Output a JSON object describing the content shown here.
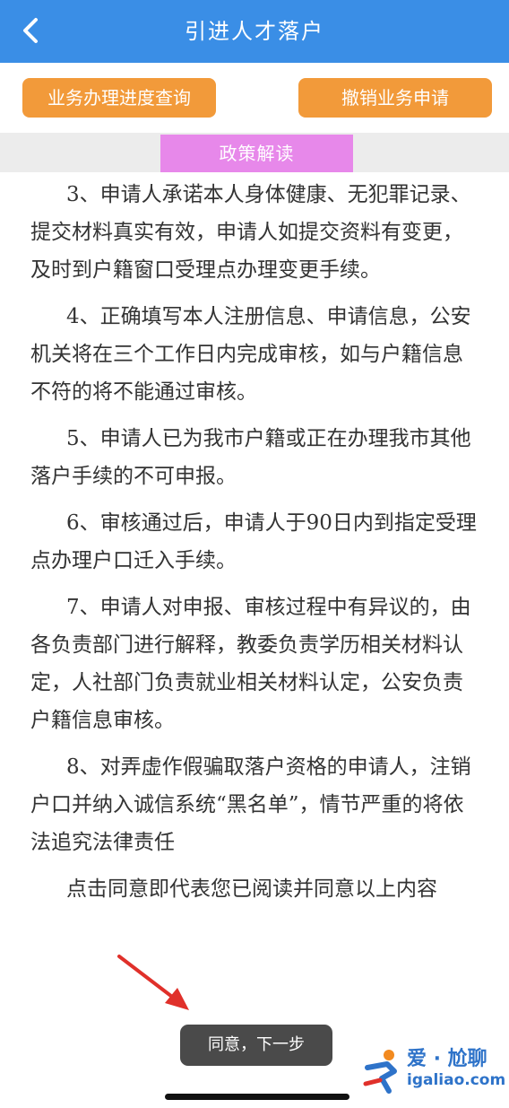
{
  "header": {
    "title": "引进人才落户",
    "back_icon": "chevron-left-icon"
  },
  "actions": {
    "progress_label": "业务办理进度查询",
    "cancel_label": "撤销业务申请"
  },
  "tab": {
    "label": "政策解读"
  },
  "content": {
    "paragraphs": [
      "3、申请人承诺本人身体健康、无犯罪记录、提交材料真实有效，申请人如提交资料有变更，及时到户籍窗口受理点办理变更手续。",
      "4、正确填写本人注册信息、申请信息，公安机关将在三个工作日内完成审核，如与户籍信息不符的将不能通过审核。",
      "5、申请人已为我市户籍或正在办理我市其他落户手续的不可申报。",
      "6、审核通过后，申请人于90日内到指定受理点办理户口迁入手续。",
      "7、申请人对申报、审核过程中有异议的，由各负责部门进行解释，教委负责学历相关材料认定，人社部门负责就业相关材料认定，公安负责户籍信息审核。",
      "8、对弄虚作假骗取落户资格的申请人，注销户口并纳入诚信系统“黑名单”，情节严重的将依法追究法律责任"
    ],
    "consent": "点击同意即代表您已阅读并同意以上内容"
  },
  "next_button": {
    "label": "同意，下一步"
  },
  "watermark": {
    "line1": "爱 · 尬聊",
    "line2": "igaliao.com"
  },
  "colors": {
    "header": "#3a8ee6",
    "orange": "#f29a3a",
    "tab": "#e788ea",
    "arrow": "#e0302a",
    "button_dark": "#4a4a4a"
  }
}
